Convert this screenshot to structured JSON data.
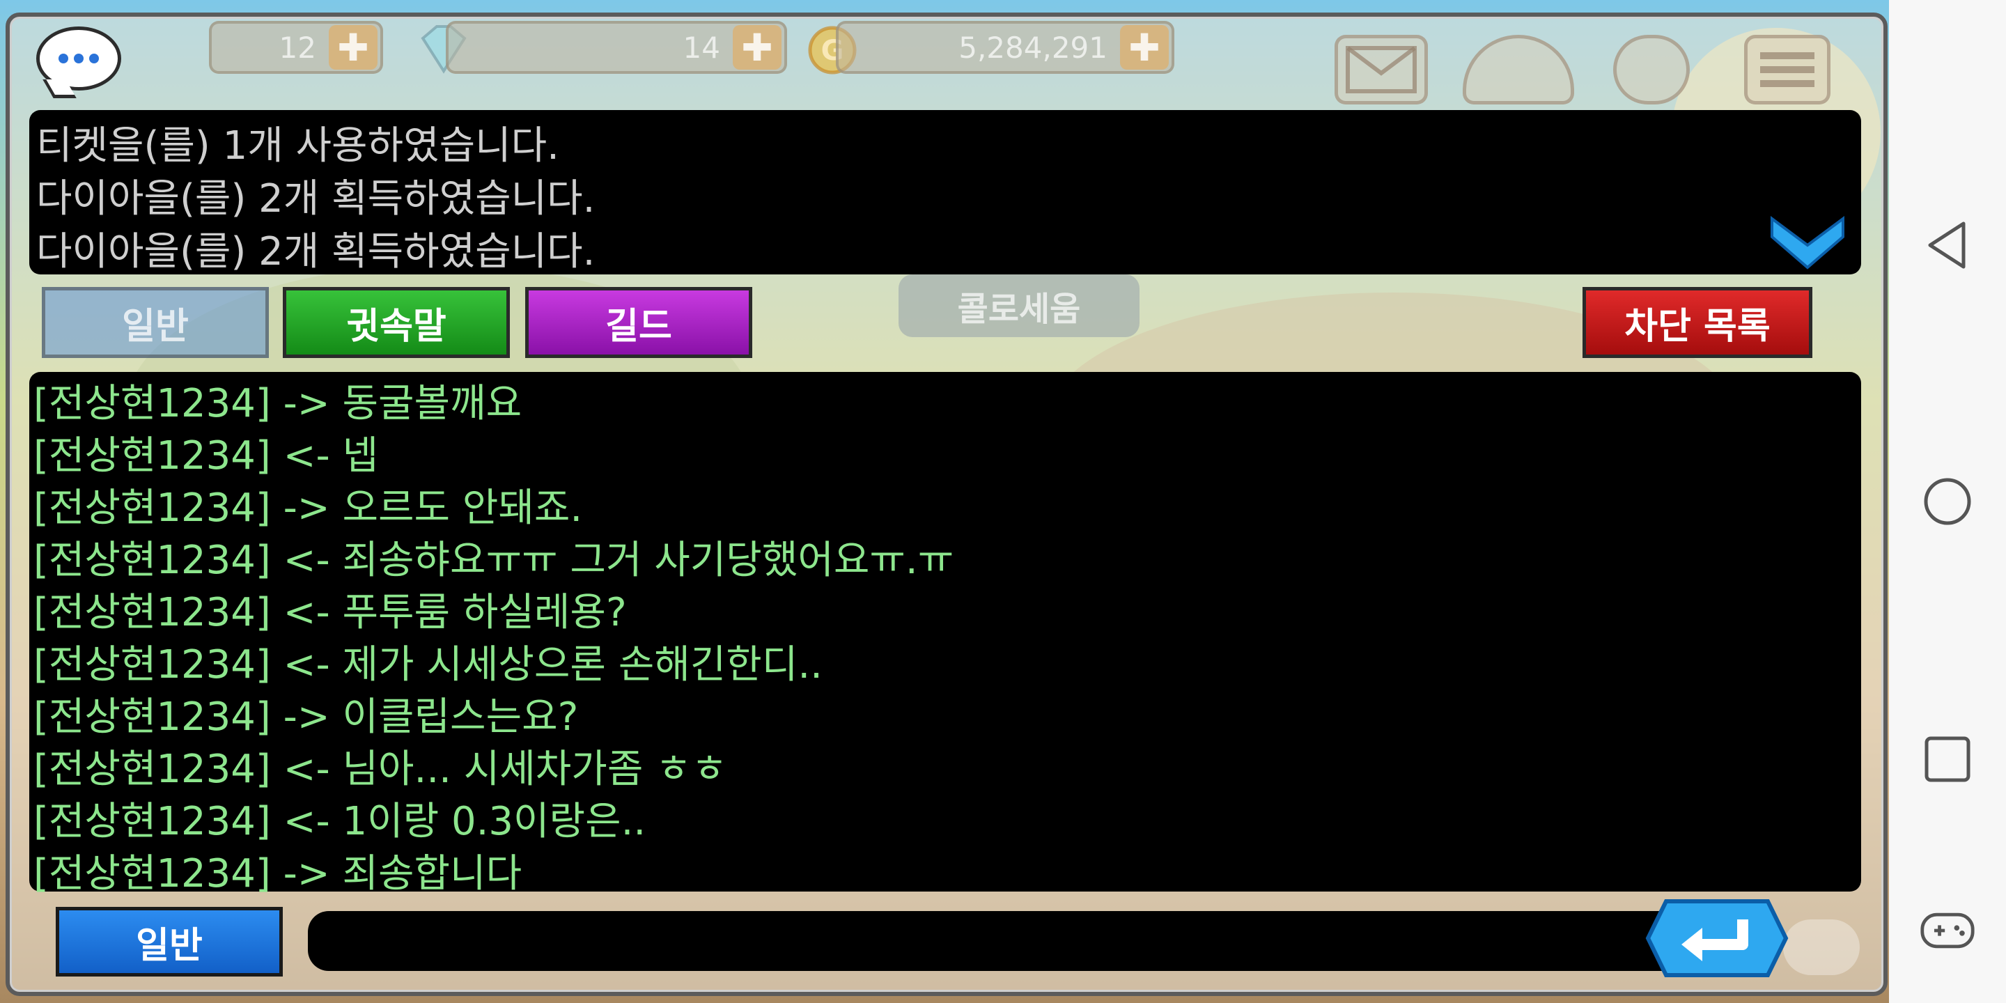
{
  "hud": {
    "tickets": "12",
    "diamonds": "14",
    "gold": "5,284,291",
    "plus": "✚"
  },
  "system_messages": [
    "티켓을(를) 1개 사용하였습니다.",
    "다이아을(를) 2개 획득하였습니다.",
    "다이아을(를) 2개 획득하였습니다."
  ],
  "tabs": {
    "general": "일반",
    "whisper": "귓속말",
    "guild": "길드",
    "block_list": "차단 목록"
  },
  "background": {
    "colosseum": "콜로세움"
  },
  "chat_log": [
    "[전상현1234] -> 동굴볼깨요",
    "[전상현1234] <- 넵",
    "[전상현1234] -> 오르도 안돼죠.",
    "[전상현1234] <- 죄송햐요ㅠㅠ 그거 사기당했어요ㅠ.ㅠ",
    "[전상현1234] <- 푸투룸 하실레용?",
    "[전상현1234] <- 제가 시세상으론 손해긴한디..",
    "[전상현1234] -> 이클립스는요?",
    "[전상현1234] <- 님아... 시세차가좀 ㅎㅎ",
    "[전상현1234] <- 1이랑 0.3이랑은..",
    "[전상현1234] -> 죄송합니다"
  ],
  "input": {
    "mode": "일반",
    "value": "",
    "placeholder": ""
  },
  "colors": {
    "chat_text": "#8de68d",
    "system_text": "#cfcfcf",
    "whisper_tab": "#1fa322",
    "guild_tab": "#a51fc8",
    "block_tab": "#c81a1a",
    "mode_button": "#1a78e0"
  }
}
